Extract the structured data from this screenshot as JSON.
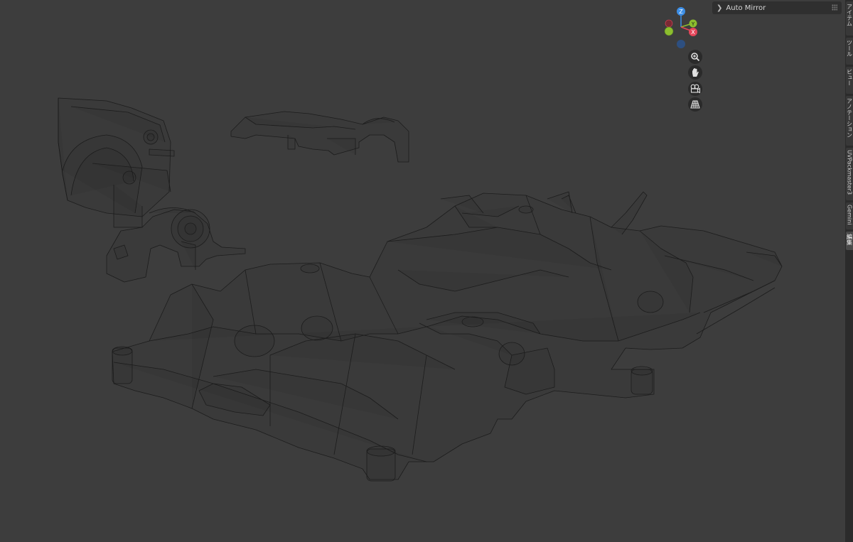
{
  "operator_panel": {
    "label": "Auto Mirror"
  },
  "sidebar": {
    "tabs": [
      {
        "label": "アイテム",
        "active": false
      },
      {
        "label": "ツール",
        "active": false
      },
      {
        "label": "ビュー",
        "active": false
      },
      {
        "label": "アノテーション",
        "active": false
      },
      {
        "label": "UVPackmaster3",
        "active": false
      },
      {
        "label": "Gemini",
        "active": false
      },
      {
        "label": "編集",
        "active": true
      }
    ]
  },
  "gizmo": {
    "axes": {
      "x": "X",
      "y": "Y",
      "z": "Z"
    },
    "colors": {
      "x": "#e5465a",
      "y": "#8cbe2e",
      "z": "#3c8ee6",
      "neg_x": "#7a2a34",
      "neg_y": "#4f6f26",
      "neg_z": "#2d4f80"
    }
  },
  "nav_buttons": [
    {
      "name": "zoom",
      "icon": "magnifier-plus-icon"
    },
    {
      "name": "pan",
      "icon": "hand-icon"
    },
    {
      "name": "camera",
      "icon": "camera-icon"
    },
    {
      "name": "perspective",
      "icon": "grid-perspective-icon"
    }
  ],
  "colors": {
    "viewport_bg": "#3d3d3d",
    "wire": "#1a1a1a",
    "panel_bg": "#2f2f2f"
  }
}
